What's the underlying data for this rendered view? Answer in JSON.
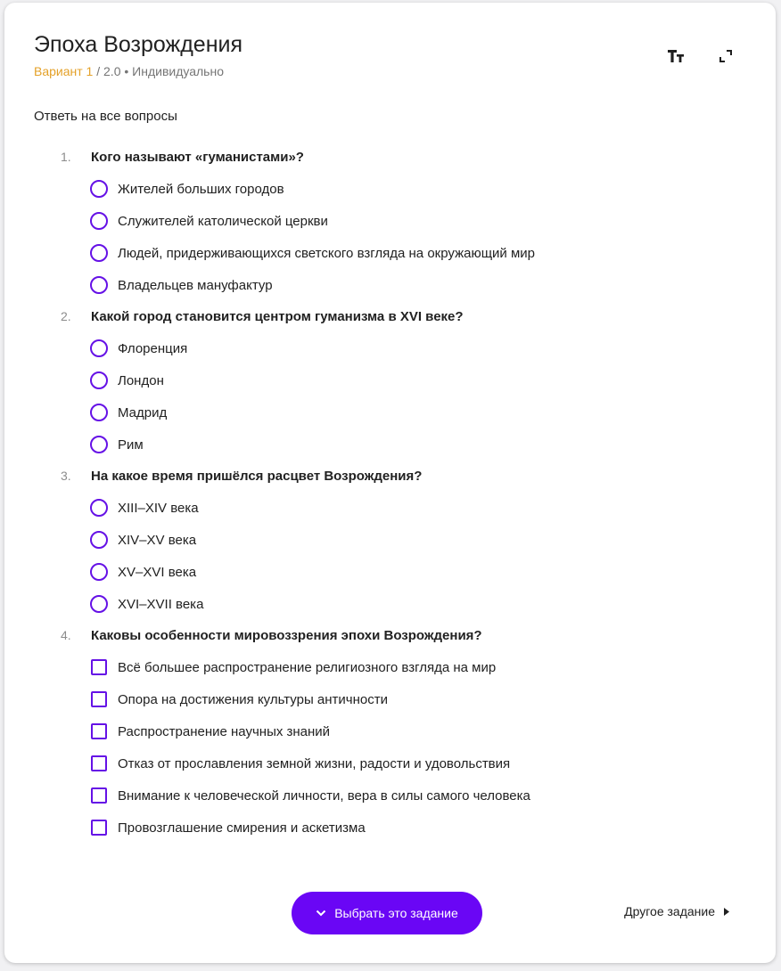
{
  "header": {
    "title": "Эпоха Возрождения",
    "variant": "Вариант 1",
    "meta": " / 2.0 • Индивидуально"
  },
  "toolbar": {
    "font_size_icon": "text-size-icon",
    "fullscreen_icon": "expand-icon"
  },
  "instruction": "Ответь на все вопросы",
  "questions": [
    {
      "number": "1.",
      "text": "Кого называют «гуманистами»?",
      "type": "radio",
      "options": [
        "Жителей больших городов",
        "Служителей католической церкви",
        "Людей, придерживающихся светского взгляда на окружающий мир",
        "Владельцев мануфактур"
      ]
    },
    {
      "number": "2.",
      "text": "Какой город становится центром гуманизма в XVI веке?",
      "type": "radio",
      "options": [
        "Флоренция",
        "Лондон",
        "Мадрид",
        "Рим"
      ]
    },
    {
      "number": "3.",
      "text": "На какое время пришёлся расцвет Возрождения?",
      "type": "radio",
      "options": [
        "XIII–XIV века",
        "XIV–XV века",
        "XV–XVI века",
        "XVI–XVII века"
      ]
    },
    {
      "number": "4.",
      "text": "Каковы особенности мировоззрения эпохи Возрождения?",
      "type": "checkbox",
      "options": [
        "Всё большее распространение религиозного взгляда на мир",
        "Опора на достижения культуры античности",
        "Распространение научных знаний",
        "Отказ от прославления земной жизни, радости и удовольствия",
        "Внимание к человеческой личности, вера в силы самого человека",
        "Провозглашение смирения и аскетизма"
      ]
    }
  ],
  "footer": {
    "select_label": "Выбрать это задание",
    "other_label": "Другое задание"
  },
  "colors": {
    "accent": "#6a06f5",
    "variant": "#e4a128"
  }
}
